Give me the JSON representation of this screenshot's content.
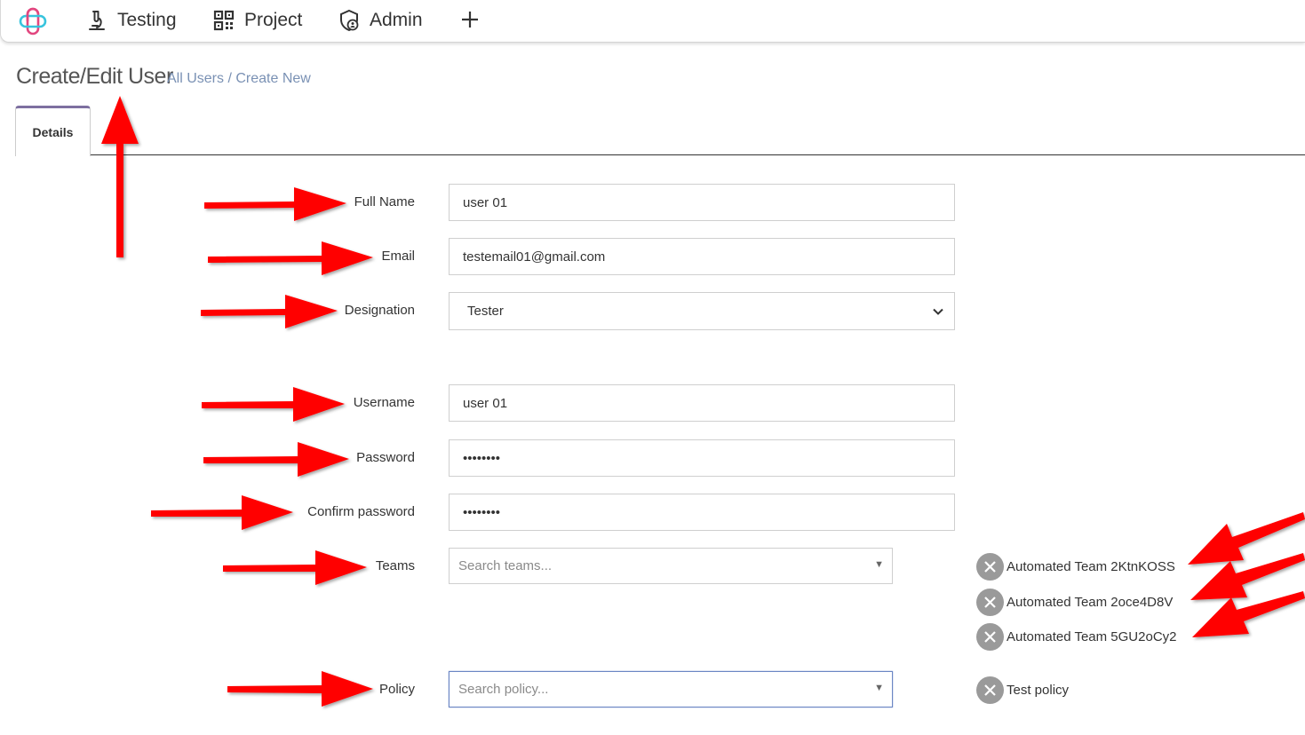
{
  "nav": {
    "items": [
      {
        "label": "Testing",
        "icon": "microscope-icon"
      },
      {
        "label": "Project",
        "icon": "qr-code-icon"
      },
      {
        "label": "Admin",
        "icon": "shield-user-icon"
      }
    ],
    "add_icon": "plus-icon"
  },
  "page": {
    "title": "Create/Edit User",
    "breadcrumb": {
      "link": "All Users",
      "separator": " / ",
      "current": "Create New"
    }
  },
  "tabs": [
    {
      "label": "Details",
      "active": true
    }
  ],
  "form": {
    "full_name": {
      "label": "Full Name",
      "value": "user 01"
    },
    "email": {
      "label": "Email",
      "value": "testemail01@gmail.com"
    },
    "designation": {
      "label": "Designation",
      "value": "Tester"
    },
    "username": {
      "label": "Username",
      "value": "user 01"
    },
    "password": {
      "label": "Password",
      "value": "••••••••"
    },
    "confirm_password": {
      "label": "Confirm password",
      "value": "••••••••"
    },
    "teams": {
      "label": "Teams",
      "placeholder": "Search teams...",
      "selected": [
        "Automated Team 2KtnKOSS",
        "Automated Team 2oce4D8V",
        "Automated Team 5GU2oCy2"
      ]
    },
    "policy": {
      "label": "Policy",
      "placeholder": "Search policy...",
      "selected": [
        "Test policy"
      ]
    }
  },
  "colors": {
    "tab_accent": "#7d6fa0",
    "breadcrumb": "#7a91b4",
    "chip_remove": "#9a9a9a",
    "annotation_arrow": "#ff0000",
    "logo_pink": "#e2467f",
    "logo_cyan": "#37c4dd"
  }
}
